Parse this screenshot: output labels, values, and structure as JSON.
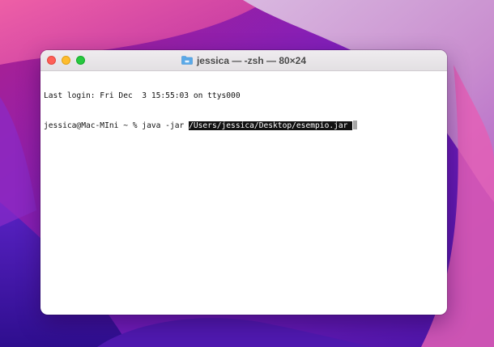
{
  "window": {
    "title": "jessica — -zsh — 80×24",
    "title_icon": "folder-icon",
    "buttons": [
      "close",
      "minimize",
      "zoom"
    ]
  },
  "terminal": {
    "last_login": "Last login: Fri Dec  3 15:55:03 on ttys000",
    "prompt": "jessica@Mac-MIni ~ % ",
    "command": "java -jar ",
    "selected_path": "/Users/jessica/Desktop/esempio.jar "
  },
  "colors": {
    "close": "#fe5f57",
    "minimize": "#febc2e",
    "zoom": "#28c840",
    "selection_bg": "#111111",
    "cursor": "#a7a7a7"
  }
}
